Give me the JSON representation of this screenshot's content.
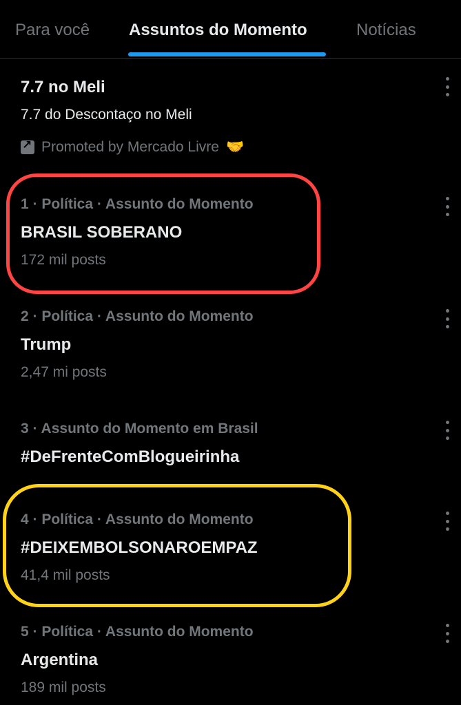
{
  "tabs": [
    "Para você",
    "Assuntos do Momento",
    "Notícias"
  ],
  "active_tab": "Assuntos do Momento",
  "promoted": {
    "title": "7.7 no Meli",
    "description": "7.7 do Descontaço no Meli",
    "promoted_by": "Promoted by Mercado Livre",
    "emoji": "🤝"
  },
  "trends": [
    {
      "meta": "1 · Política · Assunto do Momento",
      "title": "BRASIL SOBERANO",
      "count": "172 mil posts"
    },
    {
      "meta": "2 · Política · Assunto do Momento",
      "title": "Trump",
      "count": "2,47 mi posts"
    },
    {
      "meta": "3 · Assunto do Momento em Brasil",
      "title": "#DeFrenteComBlogueirinha",
      "count": ""
    },
    {
      "meta": "4 · Política · Assunto do Momento",
      "title": "#DEIXEMBOLSONAROEMPAZ",
      "count": "41,4 mil posts"
    },
    {
      "meta": "5 · Política · Assunto do Momento",
      "title": "Argentina",
      "count": "189 mil posts"
    }
  ],
  "colors": {
    "accent": "#1d9bf0",
    "highlight_red": "#ff4444",
    "highlight_yellow": "#ffd21a"
  },
  "icons": [
    "more-icon",
    "promoted-icon",
    "handshake-emoji"
  ]
}
